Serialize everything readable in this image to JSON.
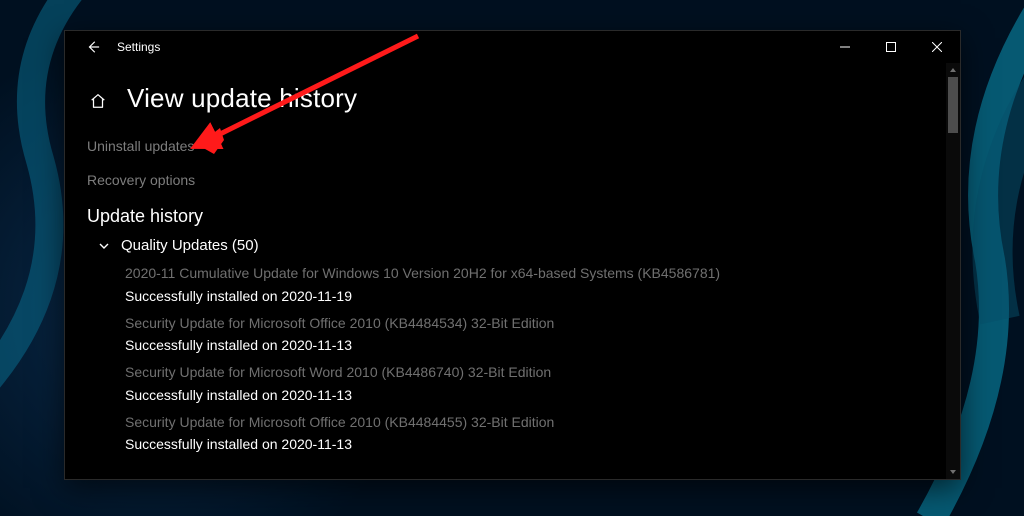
{
  "window": {
    "title": "Settings"
  },
  "page": {
    "heading": "View update history"
  },
  "links": {
    "uninstall": "Uninstall updates",
    "recovery": "Recovery options"
  },
  "section": {
    "title": "Update history"
  },
  "quality_updates": {
    "label": "Quality Updates (50)",
    "items": [
      {
        "title": "2020-11 Cumulative Update for Windows 10 Version 20H2 for x64-based Systems (KB4586781)",
        "status": "Successfully installed on 2020-11-19"
      },
      {
        "title": "Security Update for Microsoft Office 2010 (KB4484534) 32-Bit Edition",
        "status": "Successfully installed on 2020-11-13"
      },
      {
        "title": "Security Update for Microsoft Word 2010 (KB4486740) 32-Bit Edition",
        "status": "Successfully installed on 2020-11-13"
      },
      {
        "title": "Security Update for Microsoft Office 2010 (KB4484455) 32-Bit Edition",
        "status": "Successfully installed on 2020-11-13"
      }
    ]
  }
}
